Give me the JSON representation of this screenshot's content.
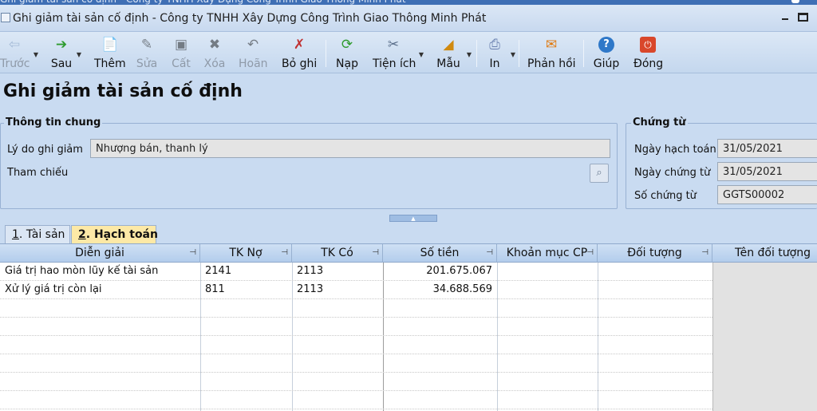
{
  "window": {
    "title": "Ghi giảm tài sản cố định - Công ty TNHH Xây Dựng Công Trình Giao Thông Minh Phát"
  },
  "toolbar": {
    "buttons": [
      {
        "label": "Trước",
        "icon": "arrow-left-icon",
        "enabled": false
      },
      {
        "label": "Sau",
        "icon": "arrow-right-icon",
        "enabled": true
      },
      {
        "label": "Thêm",
        "icon": "add-document-icon",
        "enabled": true
      },
      {
        "label": "Sửa",
        "icon": "edit-document-icon",
        "enabled": false
      },
      {
        "label": "Cất",
        "icon": "save-icon",
        "enabled": false
      },
      {
        "label": "Xóa",
        "icon": "delete-icon",
        "enabled": false
      },
      {
        "label": "Hoãn",
        "icon": "undo-icon",
        "enabled": false
      },
      {
        "label": "Bỏ ghi",
        "icon": "unpost-icon",
        "enabled": true
      },
      {
        "label": "Nạp",
        "icon": "refresh-icon",
        "enabled": true
      },
      {
        "label": "Tiện ích",
        "icon": "tools-icon",
        "enabled": true
      },
      {
        "label": "Mẫu",
        "icon": "template-icon",
        "enabled": true
      },
      {
        "label": "In",
        "icon": "print-icon",
        "enabled": true
      },
      {
        "label": "Phản hồi",
        "icon": "mail-icon",
        "enabled": true
      },
      {
        "label": "Giúp",
        "icon": "help-icon",
        "enabled": true
      },
      {
        "label": "Đóng",
        "icon": "close-icon",
        "enabled": true
      }
    ]
  },
  "page": {
    "title": "Ghi giảm tài sản cố định"
  },
  "general_info": {
    "title": "Thông tin chung",
    "reason_label": "Lý do ghi giảm",
    "reason_value": "Nhượng bán, thanh lý",
    "reference_label": "Tham chiếu"
  },
  "voucher": {
    "title": "Chứng từ",
    "posting_date_label": "Ngày hạch toán",
    "posting_date": "31/05/2021",
    "voucher_date_label": "Ngày chứng từ",
    "voucher_date": "31/05/2021",
    "voucher_no_label": "Số chứng từ",
    "voucher_no": "GGTS00002"
  },
  "tabs": [
    {
      "key": "1",
      "label": ". Tài sản",
      "active": false
    },
    {
      "key": "2",
      "label": ". Hạch toán",
      "active": true
    }
  ],
  "grid": {
    "columns": [
      "Diễn giải",
      "TK Nợ",
      "TK Có",
      "Số tiền",
      "Khoản mục CP",
      "Đối tượng",
      "Tên đối tượng"
    ],
    "rows": [
      {
        "desc": "Giá trị hao mòn lũy kế tài sản",
        "debit": "2141",
        "credit": "2113",
        "amount": "201.675.067",
        "cost_item": "",
        "object": ""
      },
      {
        "desc": "Xử lý giá trị còn lại",
        "debit": "811",
        "credit": "2113",
        "amount": "34.688.569",
        "cost_item": "",
        "object": ""
      }
    ]
  }
}
